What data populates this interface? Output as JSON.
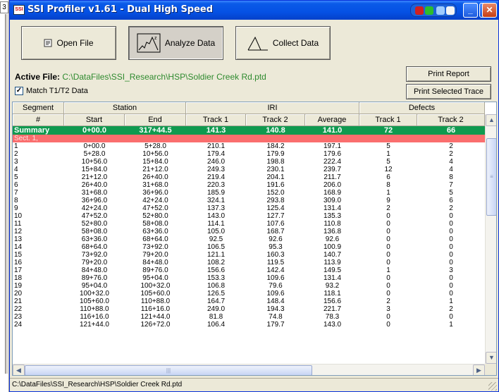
{
  "window": {
    "title": "SSI Profiler v1.61 - Dual High Speed",
    "icon_label": "SSI",
    "controls": [
      "minimize-icon",
      "maximize-icon",
      "close-icon"
    ],
    "tray_colors": [
      "#d02020",
      "#2dbd2d",
      "#9ecbff",
      "#f4f4f4"
    ]
  },
  "toolbar": {
    "open_label": "Open File",
    "analyze_label": "Analyze Data",
    "collect_label": "Collect Data"
  },
  "file": {
    "active_label": "Active File:",
    "path": "C:\\DataFiles\\SSI_Research\\HSP\\Soldier Creek Rd.ptd",
    "match_label": "Match T1/T2 Data",
    "match_checked": "✓"
  },
  "buttons": {
    "print_report": "Print Report",
    "print_selected": "Print Selected Trace"
  },
  "grid": {
    "group_headers": [
      "Segment",
      "Station",
      "IRI",
      "Defects"
    ],
    "columns": [
      "#",
      "Start",
      "End",
      "Track 1",
      "Track 2",
      "Average",
      "Track 1",
      "Track 2"
    ],
    "summary": [
      "Summary",
      "0+00.0",
      "317+44.5",
      "141.3",
      "140.8",
      "141.0",
      "72",
      "66"
    ],
    "section_label": "Sect. 1,",
    "rows": [
      [
        "1",
        "0+00.0",
        "5+28.0",
        "210.1",
        "184.2",
        "197.1",
        "5",
        "2"
      ],
      [
        "2",
        "5+28.0",
        "10+56.0",
        "179.4",
        "179.9",
        "179.6",
        "1",
        "2"
      ],
      [
        "3",
        "10+56.0",
        "15+84.0",
        "246.0",
        "198.8",
        "222.4",
        "5",
        "4"
      ],
      [
        "4",
        "15+84.0",
        "21+12.0",
        "249.3",
        "230.1",
        "239.7",
        "12",
        "4"
      ],
      [
        "5",
        "21+12.0",
        "26+40.0",
        "219.4",
        "204.1",
        "211.7",
        "6",
        "8"
      ],
      [
        "6",
        "26+40.0",
        "31+68.0",
        "220.3",
        "191.6",
        "206.0",
        "8",
        "7"
      ],
      [
        "7",
        "31+68.0",
        "36+96.0",
        "185.9",
        "152.0",
        "168.9",
        "1",
        "5"
      ],
      [
        "8",
        "36+96.0",
        "42+24.0",
        "324.1",
        "293.8",
        "309.0",
        "9",
        "6"
      ],
      [
        "9",
        "42+24.0",
        "47+52.0",
        "137.3",
        "125.4",
        "131.4",
        "2",
        "2"
      ],
      [
        "10",
        "47+52.0",
        "52+80.0",
        "143.0",
        "127.7",
        "135.3",
        "0",
        "0"
      ],
      [
        "11",
        "52+80.0",
        "58+08.0",
        "114.1",
        "107.6",
        "110.8",
        "0",
        "0"
      ],
      [
        "12",
        "58+08.0",
        "63+36.0",
        "105.0",
        "168.7",
        "136.8",
        "0",
        "0"
      ],
      [
        "13",
        "63+36.0",
        "68+64.0",
        "92.5",
        "92.6",
        "92.6",
        "0",
        "0"
      ],
      [
        "14",
        "68+64.0",
        "73+92.0",
        "106.5",
        "95.3",
        "100.9",
        "0",
        "0"
      ],
      [
        "15",
        "73+92.0",
        "79+20.0",
        "121.1",
        "160.3",
        "140.7",
        "0",
        "0"
      ],
      [
        "16",
        "79+20.0",
        "84+48.0",
        "108.2",
        "119.5",
        "113.9",
        "0",
        "0"
      ],
      [
        "17",
        "84+48.0",
        "89+76.0",
        "156.6",
        "142.4",
        "149.5",
        "1",
        "3"
      ],
      [
        "18",
        "89+76.0",
        "95+04.0",
        "153.3",
        "109.6",
        "131.4",
        "0",
        "0"
      ],
      [
        "19",
        "95+04.0",
        "100+32.0",
        "106.8",
        "79.6",
        "93.2",
        "0",
        "0"
      ],
      [
        "20",
        "100+32.0",
        "105+60.0",
        "126.5",
        "109.6",
        "118.1",
        "0",
        "0"
      ],
      [
        "21",
        "105+60.0",
        "110+88.0",
        "164.7",
        "148.4",
        "156.6",
        "2",
        "1"
      ],
      [
        "22",
        "110+88.0",
        "116+16.0",
        "249.0",
        "194.3",
        "221.7",
        "3",
        "2"
      ],
      [
        "23",
        "116+16.0",
        "121+44.0",
        "81.8",
        "74.8",
        "78.3",
        "0",
        "0"
      ],
      [
        "24",
        "121+44.0",
        "126+72.0",
        "106.4",
        "179.7",
        "143.0",
        "0",
        "1"
      ]
    ],
    "colors": {
      "summary_bg": "#0f9a4f",
      "section_bg": "#fa6e6e"
    }
  },
  "status": {
    "path": "C:\\DataFiles\\SSI_Research\\HSP\\Soldier Creek Rd.ptd"
  }
}
